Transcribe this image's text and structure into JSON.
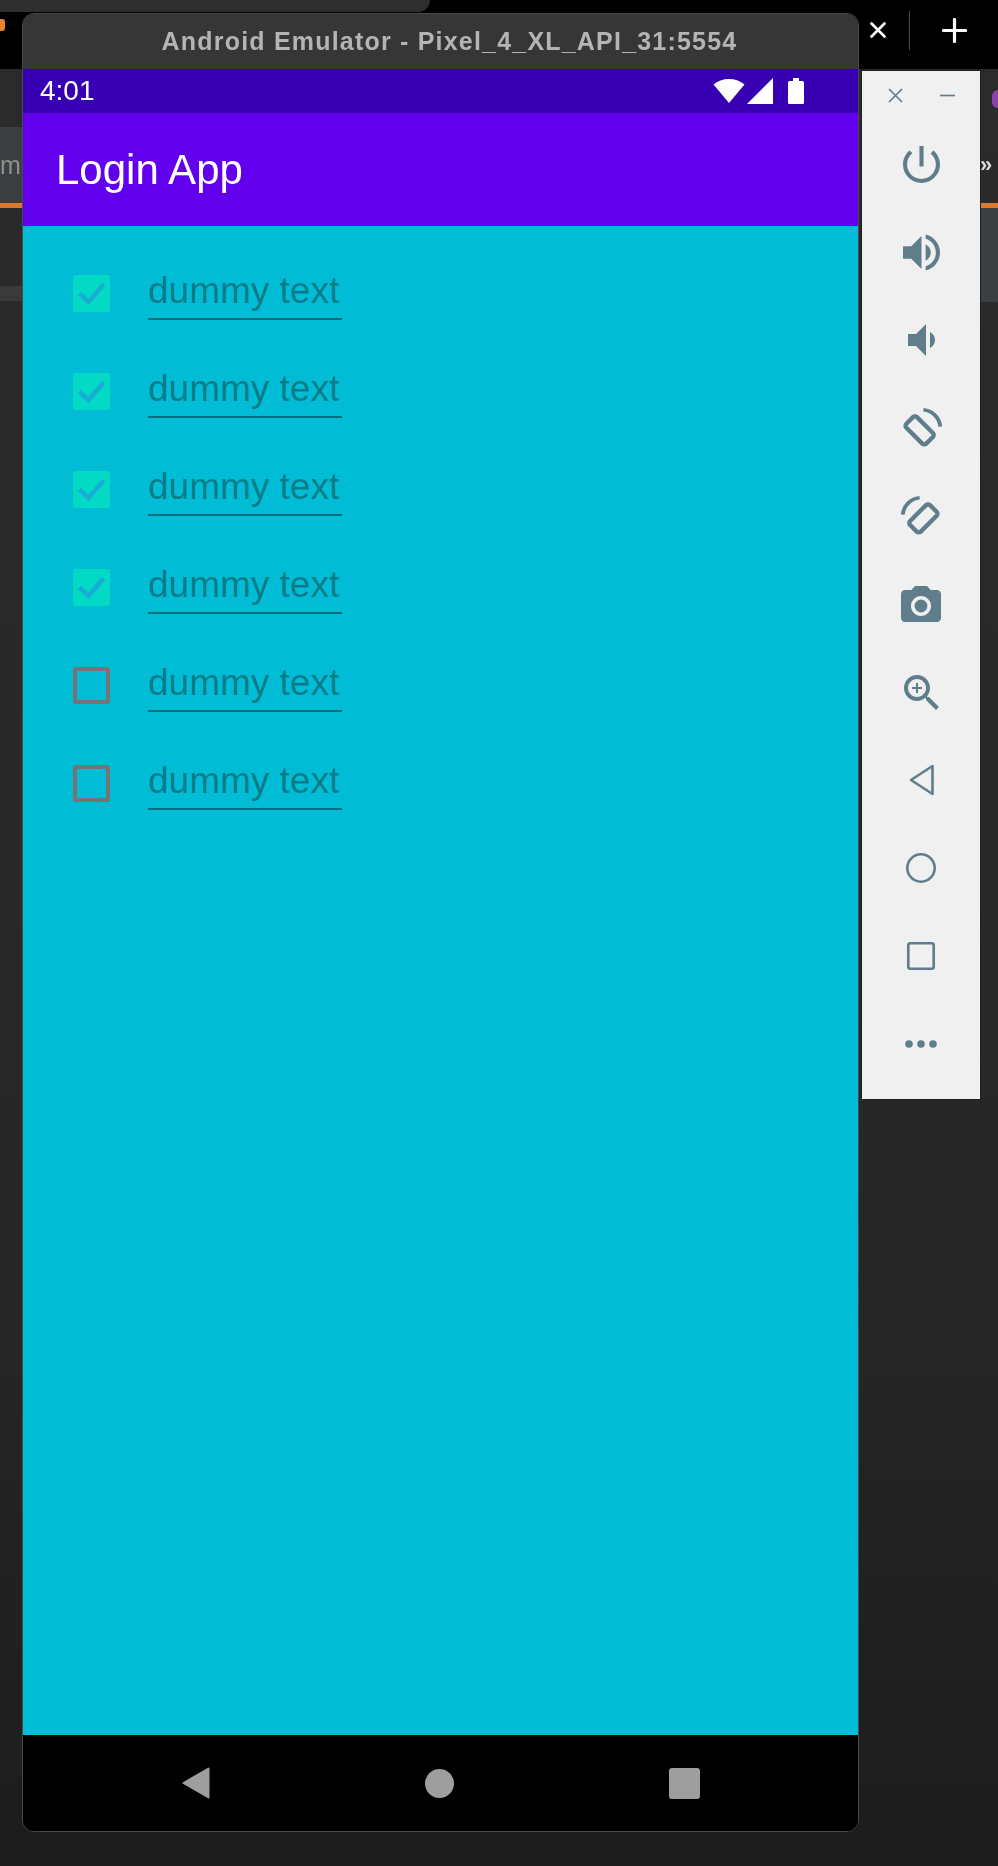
{
  "host": {
    "tab_label": "m",
    "overflow_button": "»"
  },
  "window": {
    "title": "Android Emulator - Pixel_4_XL_API_31:5554"
  },
  "status_bar": {
    "time": "4:01"
  },
  "app_bar": {
    "title": "Login App"
  },
  "rows": [
    {
      "checked": true,
      "placeholder": "dummy text"
    },
    {
      "checked": true,
      "placeholder": "dummy text"
    },
    {
      "checked": true,
      "placeholder": "dummy text"
    },
    {
      "checked": true,
      "placeholder": "dummy text"
    },
    {
      "checked": false,
      "placeholder": "dummy text"
    },
    {
      "checked": false,
      "placeholder": "dummy text"
    }
  ]
}
